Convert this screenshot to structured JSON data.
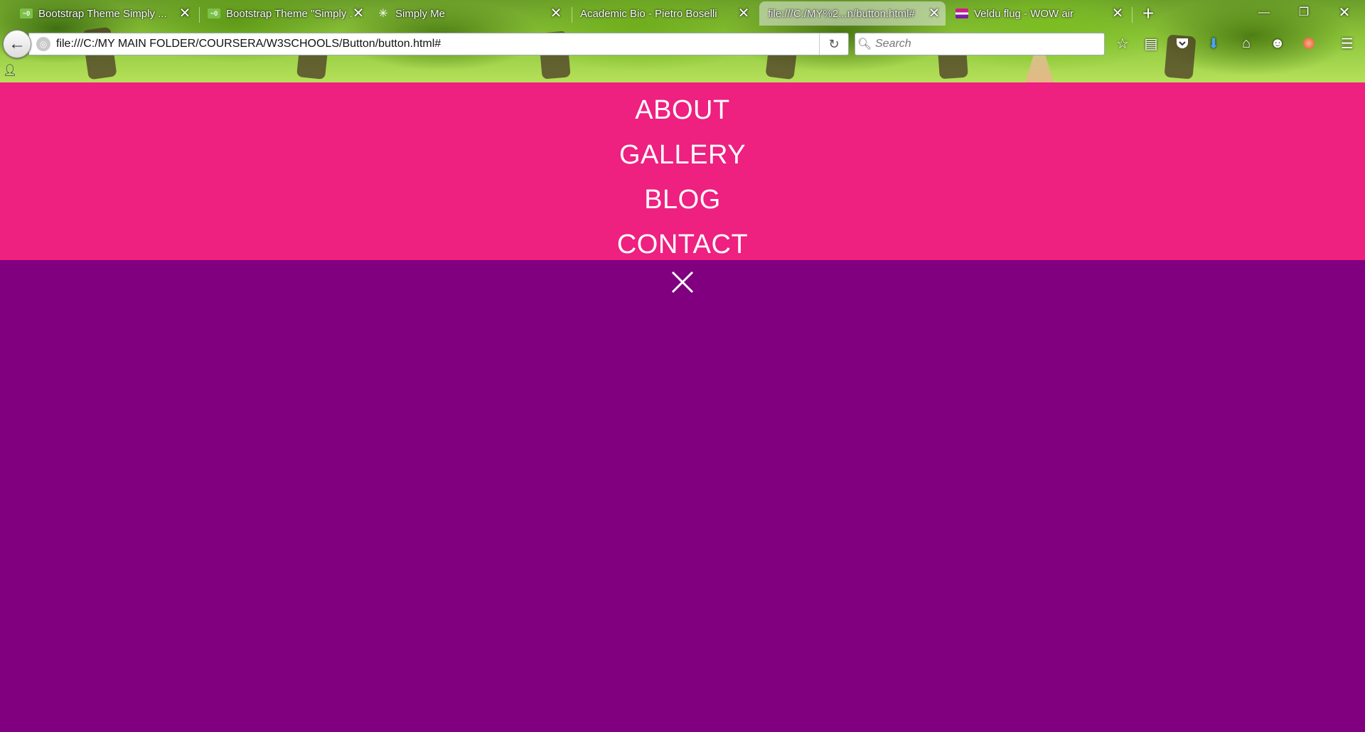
{
  "browser": {
    "tabs": [
      {
        "title": "Bootstrap Theme Simply ...",
        "favicon": "bootstrap-favicon",
        "active": false
      },
      {
        "title": "Bootstrap Theme \"Simply ...",
        "favicon": "bootstrap-favicon",
        "active": false
      },
      {
        "title": "Simply Me",
        "favicon": "loading-icon",
        "active": false
      },
      {
        "title": "Academic Bio - Pietro Boselli",
        "favicon": "",
        "active": false
      },
      {
        "title": "file:///C:/MY%2...n/button.html#",
        "favicon": "",
        "active": true
      },
      {
        "title": "Veldu flug - WOW air",
        "favicon": "wow-favicon",
        "active": false
      }
    ],
    "url": "file:///C:/MY MAIN FOLDER/COURSERA/W3SCHOOLS/Button/button.html#",
    "search_placeholder": "Search",
    "toolbar_icons": [
      "bookmark-star-icon",
      "reading-list-icon",
      "pocket-icon",
      "download-icon",
      "home-icon",
      "smiley-icon",
      "addon-icon",
      "menu-icon"
    ]
  },
  "page": {
    "menu_items": [
      "ABOUT",
      "GALLERY",
      "BLOG",
      "CONTACT"
    ],
    "close_icon": "close-icon",
    "colors": {
      "menu_background": "#ee2080",
      "page_background": "#800080",
      "menu_text": "#ffffff"
    }
  }
}
